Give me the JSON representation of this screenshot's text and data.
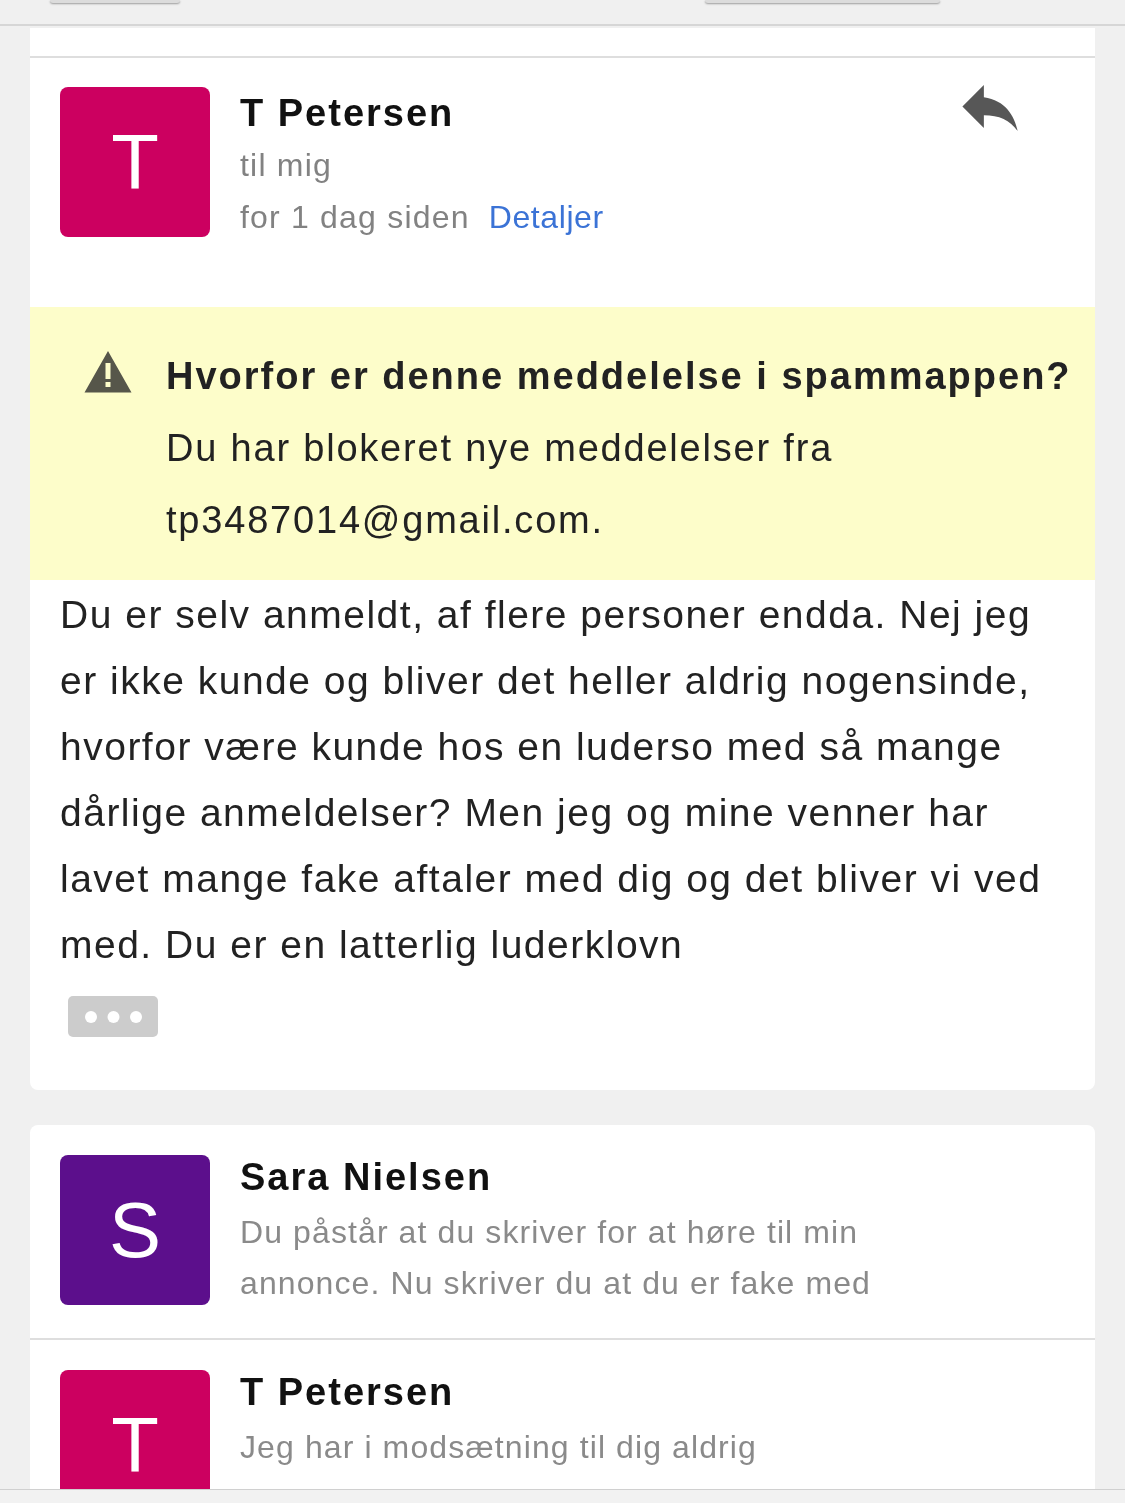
{
  "thread": [
    {
      "expanded": true,
      "sender": "T Petersen",
      "avatar_letter": "T",
      "color": "#cc0060",
      "recipient": "til mig",
      "time": "for 1 dag siden",
      "details_link": "Detaljer",
      "spam_notice": {
        "title": "Hvorfor er denne meddelelse i spammappen?",
        "text": "Du har blokeret nye meddelelser fra tp3487014@gmail.com."
      },
      "body": "Du er selv anmeldt, af flere personer endda. Nej jeg er ikke kunde og bliver det heller aldrig nogensinde, hvorfor være kunde hos en luderso med så mange dårlige anmeldelser? Men jeg og mine venner har lavet mange fake aftaler med dig og det bliver vi ved med. Du er en latterlig luderklovn"
    },
    {
      "expanded": false,
      "sender": "Sara Nielsen",
      "avatar_letter": "S",
      "color": "#5c0f8c",
      "snippet": "Du påstår at du skriver for at høre til min annonce. Nu skriver du at du er fake med"
    },
    {
      "expanded": false,
      "sender": "T Petersen",
      "avatar_letter": "T",
      "color": "#cc0060",
      "snippet": "Jeg har i modsætning til dig aldrig"
    }
  ]
}
